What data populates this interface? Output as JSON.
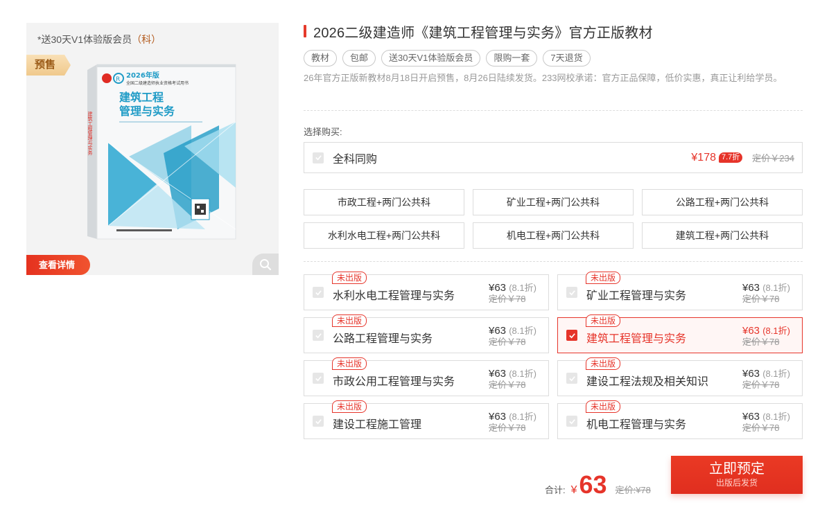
{
  "left": {
    "promo_prefix": "*送30天V1体验版会员",
    "promo_suffix": "（科）",
    "presale_tag": "预售",
    "view_detail": "查看详情",
    "book": {
      "year_line": "2026年版",
      "series_line": "全国二级建造师执业资格考试用书",
      "title_line1": "建筑工程",
      "title_line2": "管理与实务",
      "spine_text": "建筑工程管理与实务"
    }
  },
  "product": {
    "title": "2026二级建造师《建筑工程管理与实务》官方正版教材",
    "tags": [
      "教材",
      "包邮",
      "送30天V1体验版会员",
      "限购一套",
      "7天退货"
    ],
    "description": "26年官方正版新教材8月18日开启预售，8月26日陆续发货。233网校承诺：官方正品保障，低价实惠，真正让利给学员。"
  },
  "purchase": {
    "choose_label": "选择购买:",
    "all_subjects": {
      "name": "全科同购",
      "price": "¥178",
      "discount": "7.7折",
      "original": "定价￥234"
    },
    "combos": [
      "市政工程+两门公共科",
      "矿业工程+两门公共科",
      "公路工程+两门公共科",
      "水利水电工程+两门公共科",
      "机电工程+两门公共科",
      "建筑工程+两门公共科"
    ],
    "subjects": [
      {
        "badge": "未出版",
        "name": "水利水电工程管理与实务",
        "price": "¥63",
        "discount": "(8.1折)",
        "original": "定价￥78",
        "selected": false
      },
      {
        "badge": "未出版",
        "name": "矿业工程管理与实务",
        "price": "¥63",
        "discount": "(8.1折)",
        "original": "定价￥78",
        "selected": false
      },
      {
        "badge": "未出版",
        "name": "公路工程管理与实务",
        "price": "¥63",
        "discount": "(8.1折)",
        "original": "定价￥78",
        "selected": false
      },
      {
        "badge": "未出版",
        "name": "建筑工程管理与实务",
        "price": "¥63",
        "discount": "(8.1折)",
        "original": "定价￥78",
        "selected": true
      },
      {
        "badge": "未出版",
        "name": "市政公用工程管理与实务",
        "price": "¥63",
        "discount": "(8.1折)",
        "original": "定价￥78",
        "selected": false
      },
      {
        "badge": "未出版",
        "name": "建设工程法规及相关知识",
        "price": "¥63",
        "discount": "(8.1折)",
        "original": "定价￥78",
        "selected": false
      },
      {
        "badge": "未出版",
        "name": "建设工程施工管理",
        "price": "¥63",
        "discount": "(8.1折)",
        "original": "定价￥78",
        "selected": false
      },
      {
        "badge": "未出版",
        "name": "机电工程管理与实务",
        "price": "¥63",
        "discount": "(8.1折)",
        "original": "定价￥78",
        "selected": false
      }
    ]
  },
  "total": {
    "label": "合计:",
    "currency": "¥",
    "price": "63",
    "original": "定价:¥78"
  },
  "buy_button": {
    "label": "立即预定",
    "sub": "出版后发货"
  },
  "colors": {
    "accent": "#e6342a",
    "book_blue": "#1f9bc6",
    "presale_gold": "#f0c98c"
  }
}
